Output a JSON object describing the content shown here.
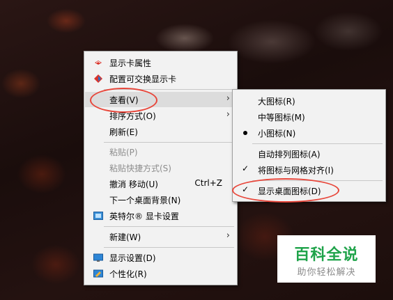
{
  "main_menu": {
    "items": [
      {
        "label": "显示卡属性",
        "icon": "display-card-icon"
      },
      {
        "label": "配置可交换显示卡",
        "icon": "graphics-switch-icon"
      },
      {
        "label": "查看(V)"
      },
      {
        "label": "排序方式(O)"
      },
      {
        "label": "刷新(E)"
      },
      {
        "label": "粘贴(P)"
      },
      {
        "label": "粘贴快捷方式(S)"
      },
      {
        "label": "撤消 移动(U)",
        "shortcut": "Ctrl+Z"
      },
      {
        "label": "下一个桌面背景(N)"
      },
      {
        "label": "英特尔® 显卡设置",
        "icon": "intel-graphics-icon"
      },
      {
        "label": "新建(W)"
      },
      {
        "label": "显示设置(D)",
        "icon": "monitor-icon"
      },
      {
        "label": "个性化(R)",
        "icon": "personalize-icon"
      }
    ]
  },
  "sub_menu": {
    "items": [
      {
        "label": "大图标(R)"
      },
      {
        "label": "中等图标(M)"
      },
      {
        "label": "小图标(N)",
        "selected": true
      },
      {
        "label": "自动排列图标(A)"
      },
      {
        "label": "将图标与网格对齐(I)",
        "checked": true
      },
      {
        "label": "显示桌面图标(D)",
        "checked": true
      }
    ]
  },
  "watermark": {
    "title": "百科全说",
    "subtitle": "助你轻松解决"
  },
  "colors": {
    "highlight_circle": "#e8463a",
    "watermark_green": "#1fa34a"
  }
}
